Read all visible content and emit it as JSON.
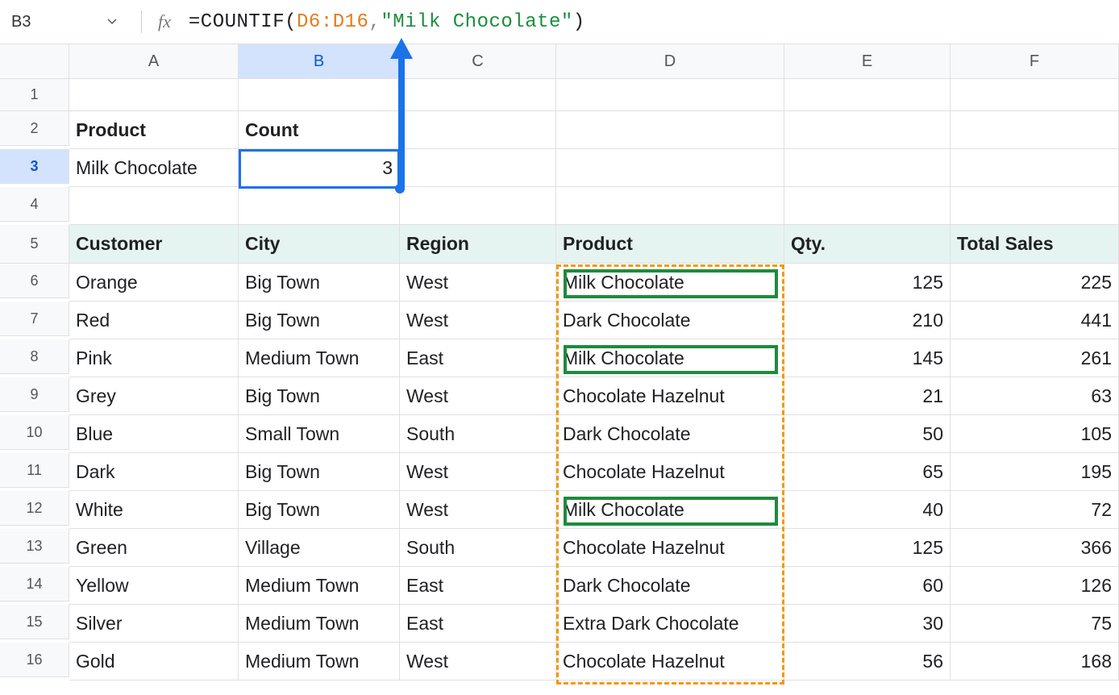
{
  "name_box": "B3",
  "formula": {
    "eq": "=",
    "fn": "COUNTIF",
    "open": "(",
    "range": "D6:D16",
    "comma": ",",
    "str": "\"Milk Chocolate\"",
    "close": ")"
  },
  "columns": [
    "A",
    "B",
    "C",
    "D",
    "E",
    "F"
  ],
  "rows": [
    "1",
    "2",
    "3",
    "4",
    "5",
    "6",
    "7",
    "8",
    "9",
    "10",
    "11",
    "12",
    "13",
    "14",
    "15",
    "16"
  ],
  "top": {
    "product_label": "Product",
    "count_label": "Count",
    "product_value": "Milk Chocolate",
    "count_value": "3"
  },
  "table": {
    "headers": {
      "customer": "Customer",
      "city": "City",
      "region": "Region",
      "product": "Product",
      "qty": "Qty.",
      "total": "Total Sales"
    },
    "rows": [
      {
        "customer": "Orange",
        "city": "Big Town",
        "region": "West",
        "product": "Milk Chocolate",
        "qty": "125",
        "total": "225"
      },
      {
        "customer": "Red",
        "city": "Big Town",
        "region": "West",
        "product": "Dark Chocolate",
        "qty": "210",
        "total": "441"
      },
      {
        "customer": "Pink",
        "city": "Medium Town",
        "region": "East",
        "product": "Milk Chocolate",
        "qty": "145",
        "total": "261"
      },
      {
        "customer": "Grey",
        "city": "Big Town",
        "region": "West",
        "product": "Chocolate Hazelnut",
        "qty": "21",
        "total": "63"
      },
      {
        "customer": "Blue",
        "city": "Small Town",
        "region": "South",
        "product": "Dark Chocolate",
        "qty": "50",
        "total": "105"
      },
      {
        "customer": "Dark",
        "city": "Big Town",
        "region": "West",
        "product": "Chocolate Hazelnut",
        "qty": "65",
        "total": "195"
      },
      {
        "customer": "White",
        "city": "Big Town",
        "region": "West",
        "product": "Milk Chocolate",
        "qty": "40",
        "total": "72"
      },
      {
        "customer": "Green",
        "city": "Village",
        "region": "South",
        "product": "Chocolate Hazelnut",
        "qty": "125",
        "total": "366"
      },
      {
        "customer": "Yellow",
        "city": "Medium Town",
        "region": "East",
        "product": "Dark Chocolate",
        "qty": "60",
        "total": "126"
      },
      {
        "customer": "Silver",
        "city": "Medium Town",
        "region": "East",
        "product": "Extra Dark Chocolate",
        "qty": "30",
        "total": "75"
      },
      {
        "customer": "Gold",
        "city": "Medium Town",
        "region": "West",
        "product": "Chocolate Hazelnut",
        "qty": "56",
        "total": "168"
      }
    ]
  }
}
